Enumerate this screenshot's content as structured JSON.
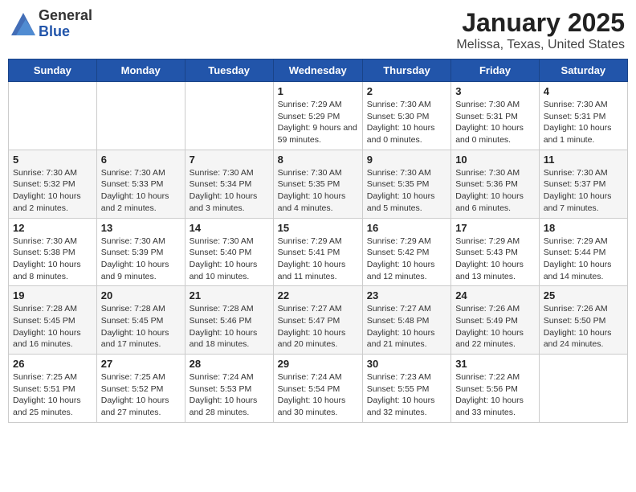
{
  "header": {
    "logo_general": "General",
    "logo_blue": "Blue",
    "title": "January 2025",
    "subtitle": "Melissa, Texas, United States"
  },
  "weekdays": [
    "Sunday",
    "Monday",
    "Tuesday",
    "Wednesday",
    "Thursday",
    "Friday",
    "Saturday"
  ],
  "weeks": [
    [
      {
        "day": "",
        "text": ""
      },
      {
        "day": "",
        "text": ""
      },
      {
        "day": "",
        "text": ""
      },
      {
        "day": "1",
        "text": "Sunrise: 7:29 AM\nSunset: 5:29 PM\nDaylight: 9 hours and 59 minutes."
      },
      {
        "day": "2",
        "text": "Sunrise: 7:30 AM\nSunset: 5:30 PM\nDaylight: 10 hours and 0 minutes."
      },
      {
        "day": "3",
        "text": "Sunrise: 7:30 AM\nSunset: 5:31 PM\nDaylight: 10 hours and 0 minutes."
      },
      {
        "day": "4",
        "text": "Sunrise: 7:30 AM\nSunset: 5:31 PM\nDaylight: 10 hours and 1 minute."
      }
    ],
    [
      {
        "day": "5",
        "text": "Sunrise: 7:30 AM\nSunset: 5:32 PM\nDaylight: 10 hours and 2 minutes."
      },
      {
        "day": "6",
        "text": "Sunrise: 7:30 AM\nSunset: 5:33 PM\nDaylight: 10 hours and 2 minutes."
      },
      {
        "day": "7",
        "text": "Sunrise: 7:30 AM\nSunset: 5:34 PM\nDaylight: 10 hours and 3 minutes."
      },
      {
        "day": "8",
        "text": "Sunrise: 7:30 AM\nSunset: 5:35 PM\nDaylight: 10 hours and 4 minutes."
      },
      {
        "day": "9",
        "text": "Sunrise: 7:30 AM\nSunset: 5:35 PM\nDaylight: 10 hours and 5 minutes."
      },
      {
        "day": "10",
        "text": "Sunrise: 7:30 AM\nSunset: 5:36 PM\nDaylight: 10 hours and 6 minutes."
      },
      {
        "day": "11",
        "text": "Sunrise: 7:30 AM\nSunset: 5:37 PM\nDaylight: 10 hours and 7 minutes."
      }
    ],
    [
      {
        "day": "12",
        "text": "Sunrise: 7:30 AM\nSunset: 5:38 PM\nDaylight: 10 hours and 8 minutes."
      },
      {
        "day": "13",
        "text": "Sunrise: 7:30 AM\nSunset: 5:39 PM\nDaylight: 10 hours and 9 minutes."
      },
      {
        "day": "14",
        "text": "Sunrise: 7:30 AM\nSunset: 5:40 PM\nDaylight: 10 hours and 10 minutes."
      },
      {
        "day": "15",
        "text": "Sunrise: 7:29 AM\nSunset: 5:41 PM\nDaylight: 10 hours and 11 minutes."
      },
      {
        "day": "16",
        "text": "Sunrise: 7:29 AM\nSunset: 5:42 PM\nDaylight: 10 hours and 12 minutes."
      },
      {
        "day": "17",
        "text": "Sunrise: 7:29 AM\nSunset: 5:43 PM\nDaylight: 10 hours and 13 minutes."
      },
      {
        "day": "18",
        "text": "Sunrise: 7:29 AM\nSunset: 5:44 PM\nDaylight: 10 hours and 14 minutes."
      }
    ],
    [
      {
        "day": "19",
        "text": "Sunrise: 7:28 AM\nSunset: 5:45 PM\nDaylight: 10 hours and 16 minutes."
      },
      {
        "day": "20",
        "text": "Sunrise: 7:28 AM\nSunset: 5:45 PM\nDaylight: 10 hours and 17 minutes."
      },
      {
        "day": "21",
        "text": "Sunrise: 7:28 AM\nSunset: 5:46 PM\nDaylight: 10 hours and 18 minutes."
      },
      {
        "day": "22",
        "text": "Sunrise: 7:27 AM\nSunset: 5:47 PM\nDaylight: 10 hours and 20 minutes."
      },
      {
        "day": "23",
        "text": "Sunrise: 7:27 AM\nSunset: 5:48 PM\nDaylight: 10 hours and 21 minutes."
      },
      {
        "day": "24",
        "text": "Sunrise: 7:26 AM\nSunset: 5:49 PM\nDaylight: 10 hours and 22 minutes."
      },
      {
        "day": "25",
        "text": "Sunrise: 7:26 AM\nSunset: 5:50 PM\nDaylight: 10 hours and 24 minutes."
      }
    ],
    [
      {
        "day": "26",
        "text": "Sunrise: 7:25 AM\nSunset: 5:51 PM\nDaylight: 10 hours and 25 minutes."
      },
      {
        "day": "27",
        "text": "Sunrise: 7:25 AM\nSunset: 5:52 PM\nDaylight: 10 hours and 27 minutes."
      },
      {
        "day": "28",
        "text": "Sunrise: 7:24 AM\nSunset: 5:53 PM\nDaylight: 10 hours and 28 minutes."
      },
      {
        "day": "29",
        "text": "Sunrise: 7:24 AM\nSunset: 5:54 PM\nDaylight: 10 hours and 30 minutes."
      },
      {
        "day": "30",
        "text": "Sunrise: 7:23 AM\nSunset: 5:55 PM\nDaylight: 10 hours and 32 minutes."
      },
      {
        "day": "31",
        "text": "Sunrise: 7:22 AM\nSunset: 5:56 PM\nDaylight: 10 hours and 33 minutes."
      },
      {
        "day": "",
        "text": ""
      }
    ]
  ]
}
